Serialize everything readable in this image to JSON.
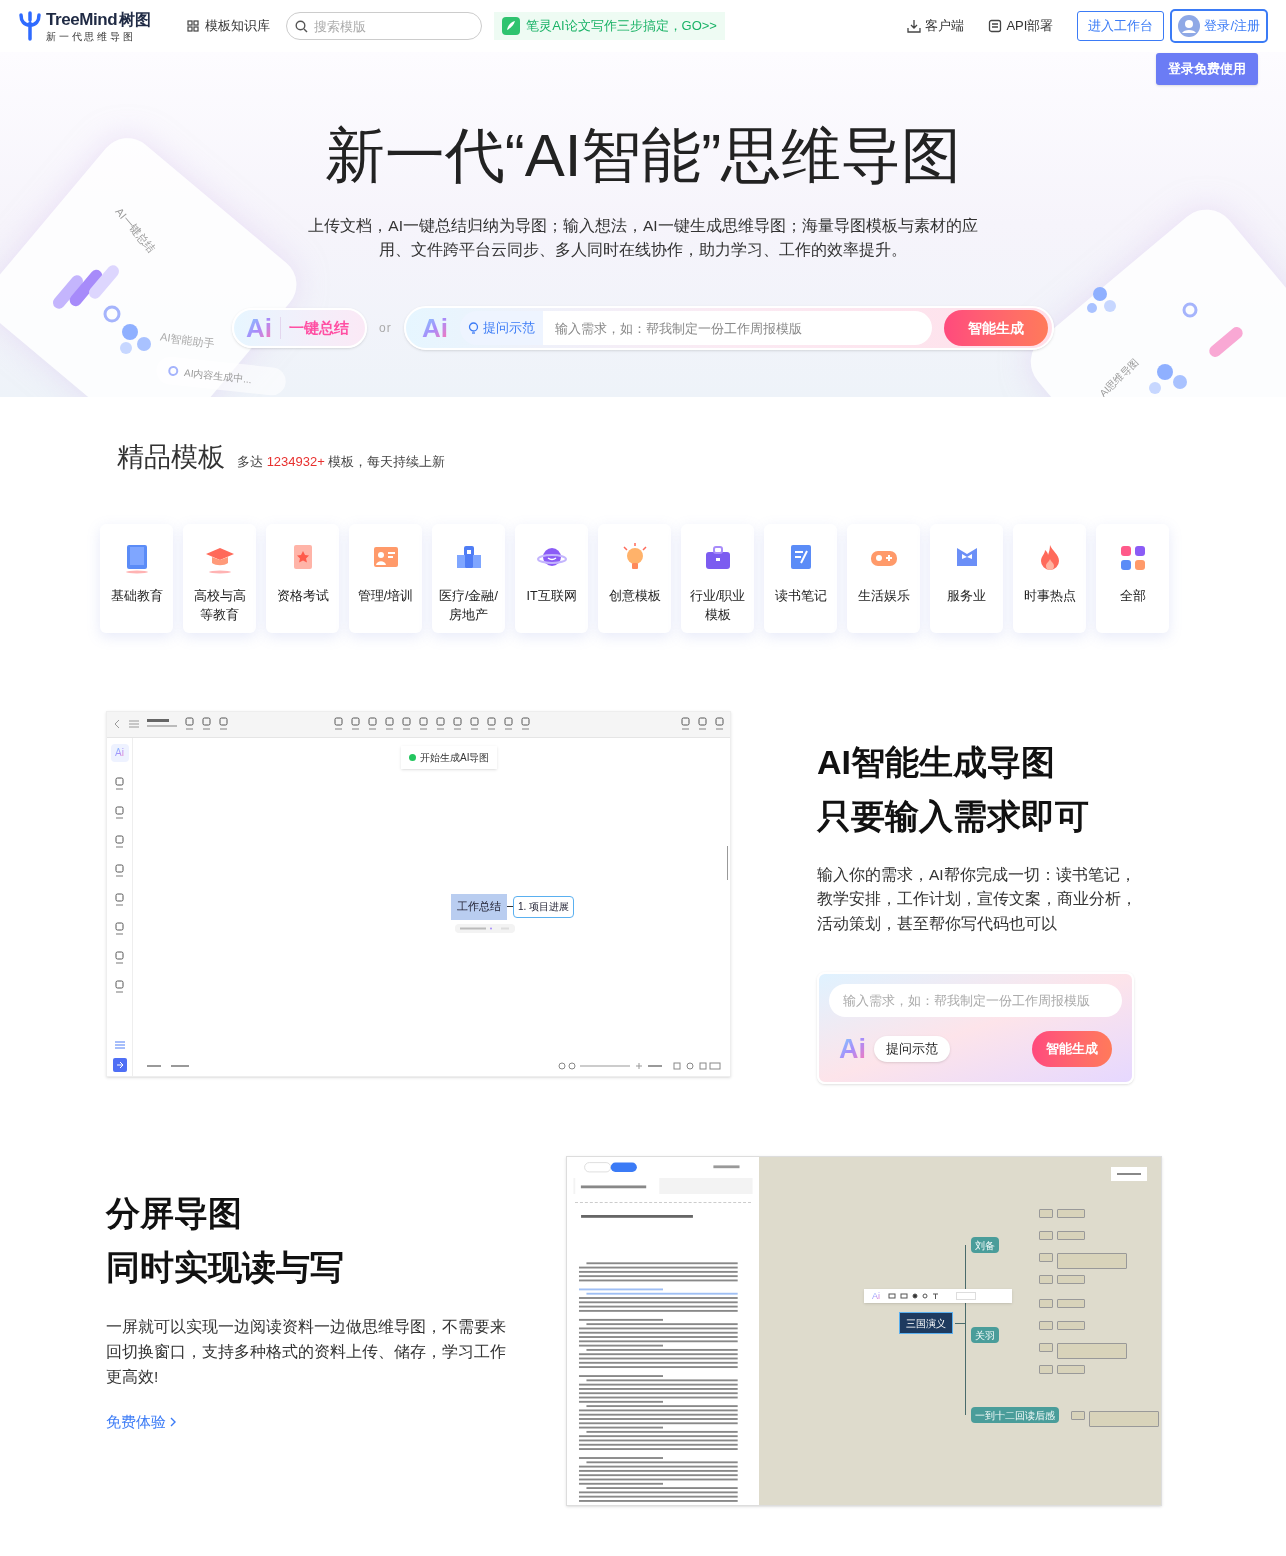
{
  "header": {
    "logo_name": "TreeMind",
    "logo_cn": "树图",
    "logo_tagline": "新 一 代 思 维 导 图",
    "nav": [
      {
        "label": "模板知识库"
      }
    ],
    "search": {
      "placeholder": "搜索模版"
    },
    "promo": "笔灵AI论文写作三步搞定，GO>>",
    "links": [
      {
        "label": "客户端"
      },
      {
        "label": "API部署"
      }
    ],
    "workspace_button": "进入工作台",
    "login_button": "登录/注册",
    "login_tooltip": "登录免费使用"
  },
  "hero": {
    "title": "新一代“AI智能”思维导图",
    "description": "上传文档，AI一键总结归纳为导图；输入想法，AI一键生成思维导图；海量导图模板与素材的应用、文件跨平台云同步、多人同时在线协作，助力学习、工作的效率提升。",
    "summary_ai": "Ai",
    "summary_label": "一键总结",
    "or": "or",
    "bar_ai": "Ai",
    "example_chip": "提问示范",
    "input": {
      "placeholder": "输入需求，如：帮我制定一份工作周报模版"
    },
    "generate_button": "智能生成",
    "decor_left": {
      "card_label": "AI一键总结",
      "assistant": "AI智能助手",
      "status": "AI内容生成中..."
    },
    "decor_right": {
      "card_label": "AI思维导图"
    }
  },
  "templates": {
    "title": "精品模板",
    "sub_prefix": "多达 ",
    "count": "1234932+",
    "sub_suffix": " 模板，每天持续上新",
    "items": [
      {
        "label": "基础教育"
      },
      {
        "label": "高校与高等教育"
      },
      {
        "label": "资格考试"
      },
      {
        "label": "管理/培训"
      },
      {
        "label": "医疗/金融/房地产"
      },
      {
        "label": "IT互联网"
      },
      {
        "label": "创意模板"
      },
      {
        "label": "行业/职业模板"
      },
      {
        "label": "读书笔记"
      },
      {
        "label": "生活娱乐"
      },
      {
        "label": "服务业"
      },
      {
        "label": "时事热点"
      },
      {
        "label": "全部"
      }
    ]
  },
  "feature_ai": {
    "app": {
      "sidebar_ai": "Ai",
      "toast": "开始生成AI导图",
      "root": "工作总结",
      "child": "1. 项目进展"
    },
    "headings": [
      "AI智能生成导图",
      "只要输入需求即可"
    ],
    "description": "输入你的需求，AI帮你完成一切：读书笔记，教学安排，工作计划，宣传文案，商业分析，活动策划，甚至帮你写代码也可以",
    "input": {
      "placeholder": "输入需求，如：帮我制定一份工作周报模版"
    },
    "ai": "Ai",
    "example_chip": "提问示范",
    "generate_button": "智能生成"
  },
  "feature_split": {
    "headings": [
      "分屏导图",
      "同时实现读与写"
    ],
    "description": "一屏就可以实现一边阅读资料一边做思维导图，不需要来回切换窗口，支持多种格式的资料上传、储存，学习工作更高效!",
    "link": "免费体验",
    "app": {
      "toolbar_ai": "Ai",
      "root": "三国演义",
      "branches": [
        {
          "label": "刘备"
        },
        {
          "label": "关羽"
        },
        {
          "label": "一到十二回读后感"
        }
      ]
    }
  }
}
